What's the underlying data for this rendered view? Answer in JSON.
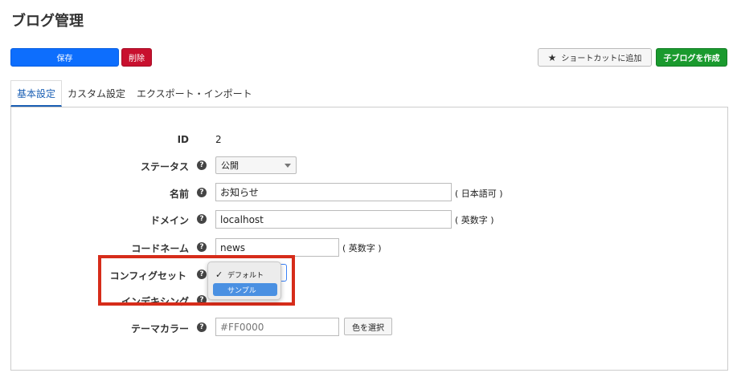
{
  "page": {
    "title": "ブログ管理"
  },
  "toolbar": {
    "save_label": "保存",
    "delete_label": "削除",
    "shortcut_label": "ショートカットに追加",
    "child_blog_label": "子ブログを作成"
  },
  "tabs": [
    {
      "label": "基本設定",
      "active": true
    },
    {
      "label": "カスタム設定",
      "active": false
    },
    {
      "label": "エクスポート・インポート",
      "active": false
    }
  ],
  "form": {
    "help_glyph": "?",
    "id": {
      "label": "ID",
      "value": "2"
    },
    "status": {
      "label": "ステータス",
      "value": "公開"
    },
    "name": {
      "label": "名前",
      "value": "お知らせ",
      "hint": "( 日本語可 )"
    },
    "domain": {
      "label": "ドメイン",
      "value": "localhost",
      "hint": "( 英数字 )"
    },
    "codename": {
      "label": "コードネーム",
      "value": "news",
      "hint": "( 英数字 )"
    },
    "config_set": {
      "label": "コンフィグセット",
      "options": [
        {
          "label": "デフォルト",
          "checked": true
        },
        {
          "label": "サンプル",
          "highlighted": true
        }
      ]
    },
    "indexing": {
      "label": "インデキシング"
    },
    "theme_color": {
      "label": "テーマカラー",
      "placeholder": "#FF0000",
      "button_label": "色を選択"
    }
  },
  "colors": {
    "primary": "#0d6efd",
    "danger": "#c8102e",
    "success": "#1a9a2e",
    "tab_active": "#1a5fb4",
    "highlight_box": "#d62c1a"
  },
  "icons": {
    "shortcut": "star-icon",
    "checkmark": "✓"
  }
}
